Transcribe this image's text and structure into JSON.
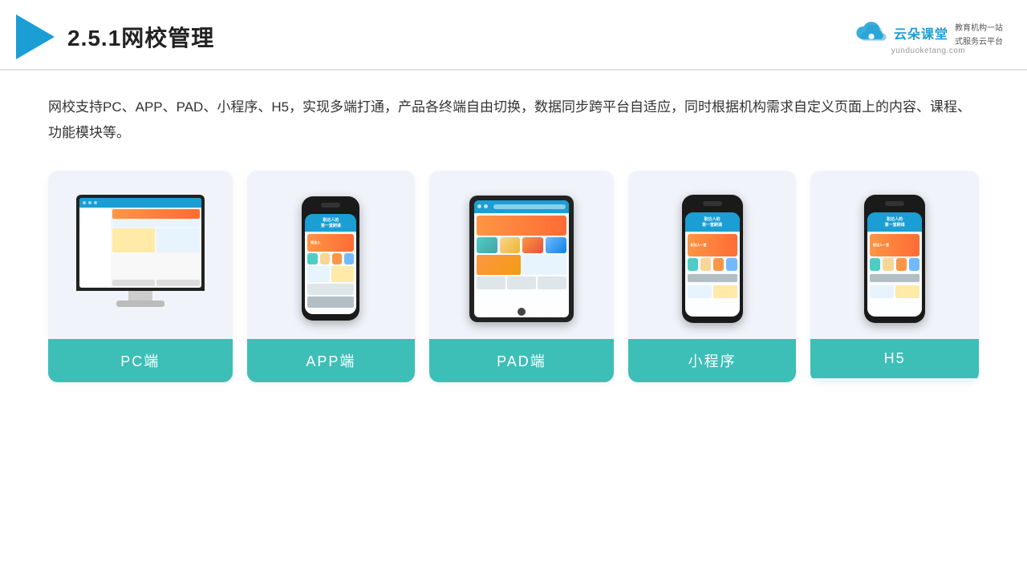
{
  "header": {
    "title": "2.5.1网校管理",
    "brand_name": "云朵课堂",
    "brand_url": "yunduoketang.com",
    "brand_slogan_line1": "教育机构一站",
    "brand_slogan_line2": "式服务云平台"
  },
  "description": "网校支持PC、APP、PAD、小程序、H5，实现多端打通，产品各终端自由切换，数据同步跨平台自适应，同时根据机构需求自定义页面上的内容、课程、功能模块等。",
  "cards": [
    {
      "id": "pc",
      "label": "PC端"
    },
    {
      "id": "app",
      "label": "APP端"
    },
    {
      "id": "pad",
      "label": "PAD端"
    },
    {
      "id": "miniprogram",
      "label": "小程序"
    },
    {
      "id": "h5",
      "label": "H5"
    }
  ]
}
